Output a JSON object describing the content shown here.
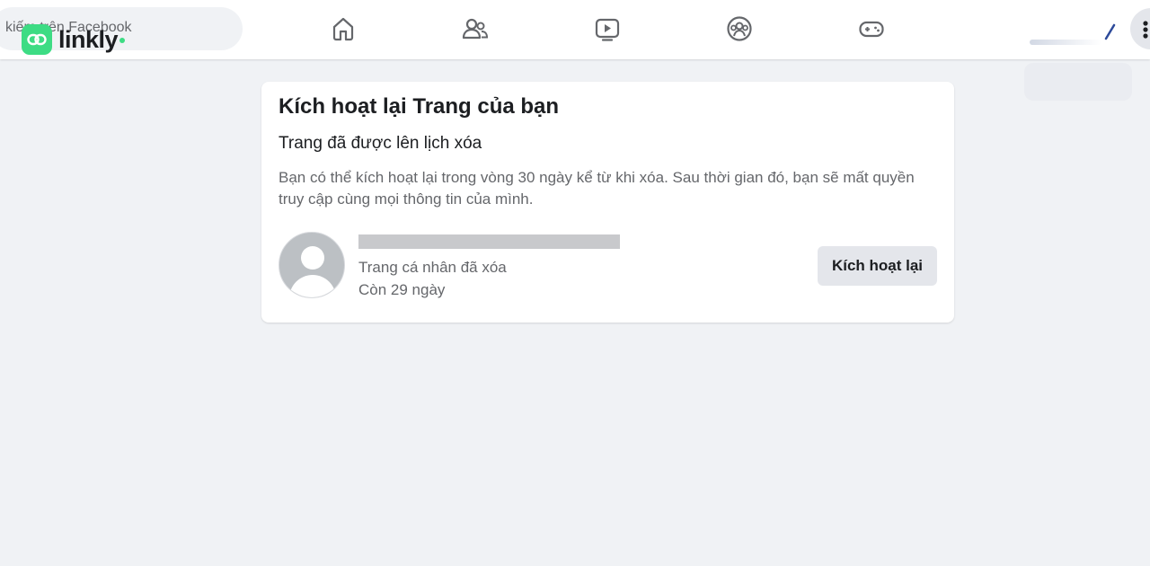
{
  "header": {
    "search": {
      "text": "kiếm trên Facebook"
    },
    "logo": {
      "text": "linkly",
      "accent": "#3ddc84"
    },
    "nav": [
      {
        "icon": "home-icon"
      },
      {
        "icon": "friends-icon"
      },
      {
        "icon": "watch-icon"
      },
      {
        "icon": "groups-icon"
      },
      {
        "icon": "gaming-icon"
      }
    ]
  },
  "card": {
    "title": "Kích hoạt lại Trang của bạn",
    "subtitle": "Trang đã được lên lịch xóa",
    "description": "Bạn có thể kích hoạt lại trong vòng 30 ngày kể từ khi xóa. Sau thời gian đó, bạn sẽ mất quyền truy cập cùng mọi thông tin của mình.",
    "profile": {
      "status": "Trang cá nhân đã xóa",
      "days_left": "Còn 29 ngày"
    },
    "button_label": "Kích hoạt lại"
  },
  "colors": {
    "background": "#f0f2f5",
    "card": "#ffffff",
    "button": "#e4e6eb",
    "secondary_text": "#65676b"
  }
}
